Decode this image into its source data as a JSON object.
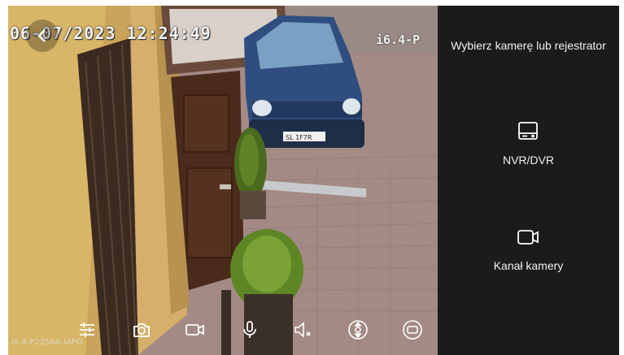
{
  "video": {
    "timestamp": "06-07/2023 12:24:49",
    "camera_label_top": "i6.4-P",
    "camera_label_bottom": "i6.4-P2350A-IAPG",
    "plate_text": "SL 1F7R"
  },
  "back_button": {
    "icon": "chevron-left-icon"
  },
  "toolbar": {
    "icons": [
      "settings-sliders-icon",
      "camera-snapshot-icon",
      "video-record-icon",
      "microphone-icon",
      "speaker-muted-icon",
      "ptz-joystick-icon",
      "screen-fit-icon"
    ]
  },
  "panel": {
    "title": "Wybierz kamerę lub rejestrator",
    "options": [
      {
        "label": "NVR/DVR",
        "icon": "nvr-recorder-icon"
      },
      {
        "label": "Kanał kamery",
        "icon": "camera-channel-icon"
      }
    ]
  },
  "colors": {
    "panel_bg": "#1b1b1b",
    "wall_yellow": "#d8b667",
    "door_brown": "#4a2a1b",
    "car_blue": "#2f4d7f",
    "paving": "#a48a84"
  }
}
